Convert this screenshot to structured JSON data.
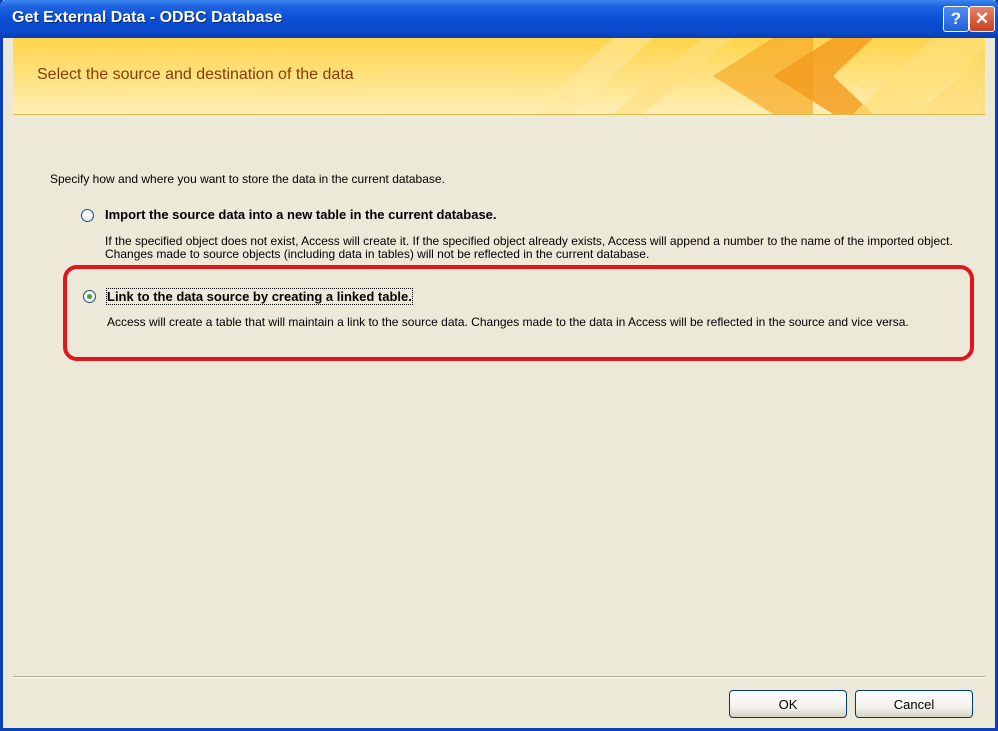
{
  "window": {
    "title": "Get External Data - ODBC Database",
    "help_button": "?",
    "close_button": "✕"
  },
  "banner": {
    "heading": "Select the source and destination of the data"
  },
  "instructions": "Specify how and where you want to store the data in the current database.",
  "options": [
    {
      "label": "Import the source data into a new table in the current database.",
      "description": "If the specified object does not exist, Access will create it. If the specified object already exists, Access will append a number to the name of the imported object. Changes made to source objects (including data in tables) will not be reflected in the current database.",
      "selected": false
    },
    {
      "label": "Link to the data source by creating a linked table.",
      "description": "Access will create a table that will maintain a link to the source data. Changes made to the data in Access will be reflected in the source and vice versa.",
      "selected": true
    }
  ],
  "buttons": {
    "ok": "OK",
    "cancel": "Cancel"
  },
  "colors": {
    "titlebar": "#0a4fd6",
    "banner": "#ffd34a",
    "banner_text": "#8a3b00",
    "highlight": "#e0161c",
    "dialog_bg": "#ece9d8"
  }
}
